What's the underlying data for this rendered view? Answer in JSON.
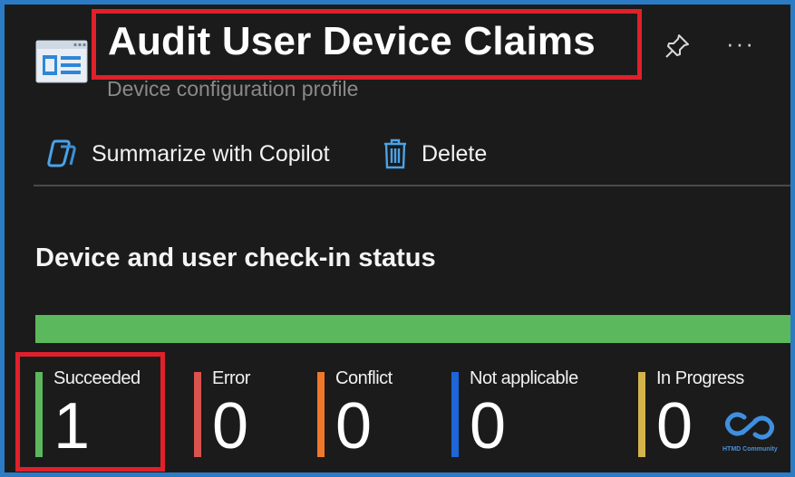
{
  "header": {
    "title": "Audit User Device Claims",
    "subtitle": "Device configuration profile",
    "icon": "profile-window-icon",
    "more_glyph": "···"
  },
  "toolbar": {
    "copilot_label": "Summarize with Copilot",
    "delete_label": "Delete"
  },
  "section": {
    "title": "Device and user check-in status"
  },
  "status_bar": {
    "succeeded_fraction": 1.0,
    "color": "#5cb85c"
  },
  "statuses": [
    {
      "label": "Succeeded",
      "value": "1",
      "color": "#5cb85c"
    },
    {
      "label": "Error",
      "value": "0",
      "color": "#d9534f"
    },
    {
      "label": "Conflict",
      "value": "0",
      "color": "#f0782a"
    },
    {
      "label": "Not applicable",
      "value": "0",
      "color": "#1e66d8"
    },
    {
      "label": "In Progress",
      "value": "0",
      "color": "#d4b44a"
    }
  ],
  "watermark": {
    "text": "HTMD Community"
  },
  "colors": {
    "highlight": "#e0202a",
    "background": "#1b1b1b",
    "accent": "#4aa3e8"
  }
}
